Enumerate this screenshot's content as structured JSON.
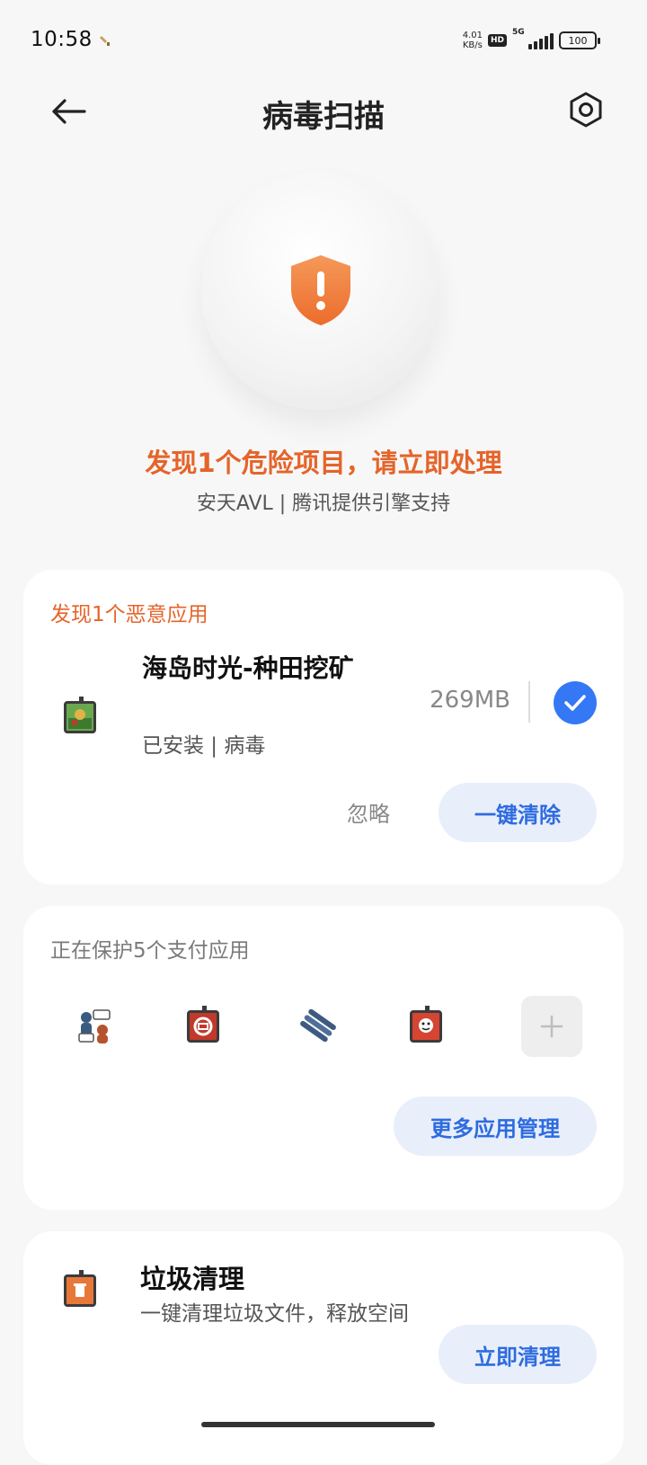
{
  "status_bar": {
    "time": "10:58",
    "net_speed_value": "4.01",
    "net_speed_unit": "KB/s",
    "hd": "HD",
    "signal_type": "5G",
    "battery": "100"
  },
  "header": {
    "title": "病毒扫描",
    "back_icon": "arrow-left-icon",
    "settings_icon": "settings-hexagon-icon"
  },
  "scan_result": {
    "shield_icon": "warning-shield-icon",
    "warning_text": "发现1个危险项目，请立即处理",
    "engine_text": "安天AVL | 腾讯提供引擎支持"
  },
  "malicious_card": {
    "heading": "发现1个恶意应用",
    "app": {
      "name": "海岛时光-种田挖矿",
      "status": "已安装 | 病毒",
      "size": "269MB",
      "checked": true
    },
    "ignore_label": "忽略",
    "clean_label": "一键清除"
  },
  "payment_card": {
    "heading": "正在保护5个支付应用",
    "apps": [
      {
        "icon": "messaging-app-icon"
      },
      {
        "icon": "bank-app-icon"
      },
      {
        "icon": "wallet-app-icon"
      },
      {
        "icon": "shopping-app-icon"
      }
    ],
    "more_label": "更多应用管理"
  },
  "junk_card": {
    "title": "垃圾清理",
    "description": "一键清理垃圾文件，释放空间",
    "button_label": "立即清理"
  },
  "colors": {
    "accent_orange": "#e5642a",
    "accent_blue": "#3478f6",
    "button_bg": "#e8effb"
  }
}
